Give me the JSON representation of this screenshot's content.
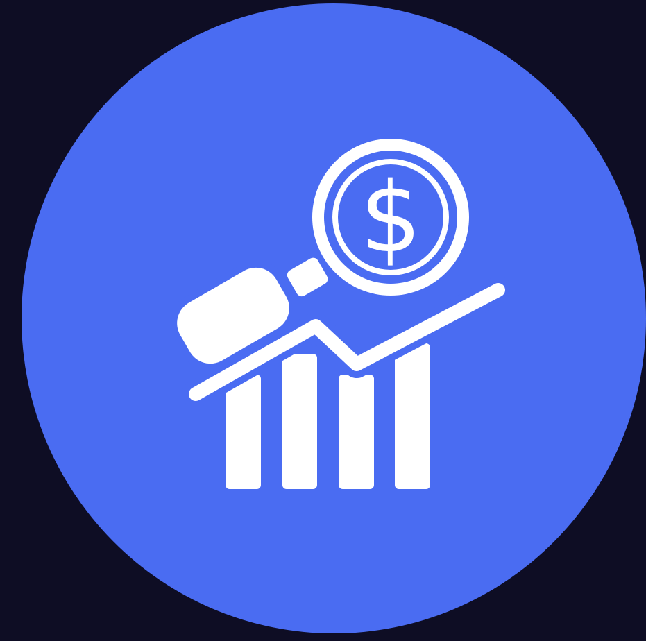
{
  "icon": {
    "name": "financial-analysis-icon",
    "symbol": "$",
    "colors": {
      "background": "#0e0d24",
      "badge": "#4a6cf2",
      "foreground": "#ffffff"
    },
    "bars": 4
  }
}
